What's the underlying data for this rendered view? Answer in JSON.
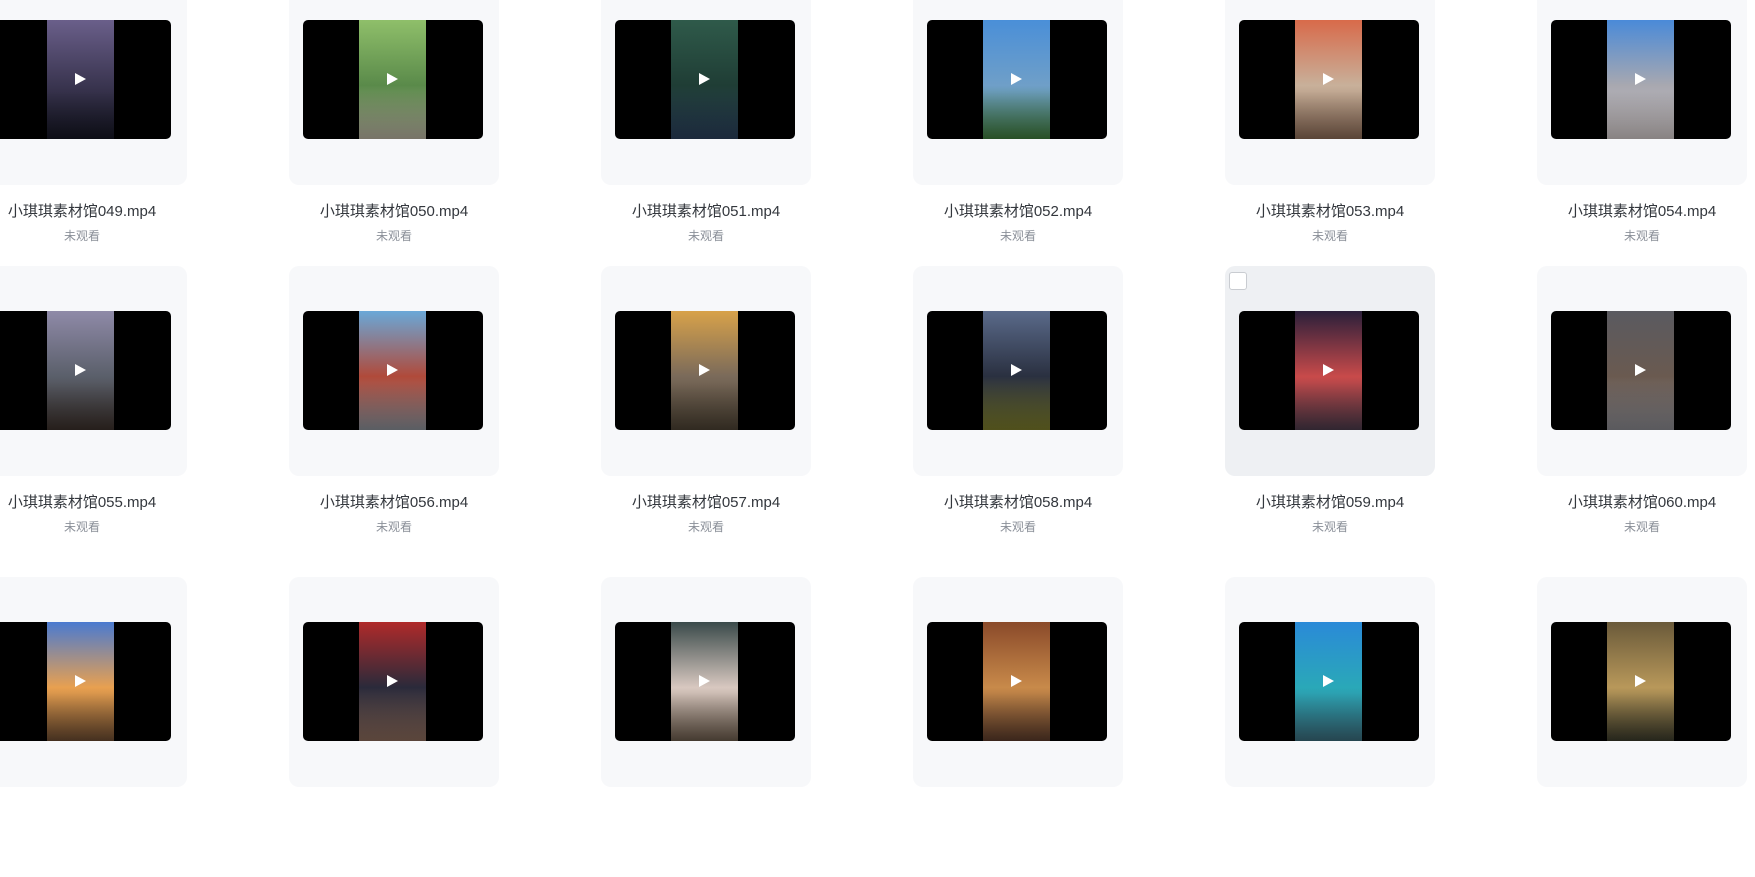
{
  "files": [
    {
      "name": "小琪琪素材馆049.mp4",
      "status": "未观看",
      "colors": [
        "#6a5f8a",
        "#3a3550",
        "#141522"
      ]
    },
    {
      "name": "小琪琪素材馆050.mp4",
      "status": "未观看",
      "colors": [
        "#8fbf6a",
        "#5a8a4a",
        "#b8b2a0"
      ]
    },
    {
      "name": "小琪琪素材馆051.mp4",
      "status": "未观看",
      "colors": [
        "#2f5a4a",
        "#1f3d35",
        "#2a3f5a"
      ]
    },
    {
      "name": "小琪琪素材馆052.mp4",
      "status": "未观看",
      "colors": [
        "#4a8fd8",
        "#6f9fc8",
        "#3f7a3a"
      ]
    },
    {
      "name": "小琪琪素材馆053.mp4",
      "status": "未观看",
      "colors": [
        "#d86a4a",
        "#c8b09a",
        "#8a6a55"
      ]
    },
    {
      "name": "小琪琪素材馆054.mp4",
      "status": "未观看",
      "colors": [
        "#4a8ad8",
        "#a8a8b0",
        "#d0c8c8"
      ]
    },
    {
      "name": "小琪琪素材馆055.mp4",
      "status": "未观看",
      "colors": [
        "#8f8aa8",
        "#5a5f6a",
        "#3a2f2a"
      ]
    },
    {
      "name": "小琪琪素材馆056.mp4",
      "status": "未观看",
      "colors": [
        "#6aa8d8",
        "#b04a3a",
        "#8a9098"
      ]
    },
    {
      "name": "小琪琪素材馆057.mp4",
      "status": "未观看",
      "colors": [
        "#d8a24a",
        "#7a6a5a",
        "#4a4032"
      ]
    },
    {
      "name": "小琪琪素材馆058.mp4",
      "status": "未观看",
      "colors": [
        "#5a6a8a",
        "#2a3040",
        "#7a7a2a"
      ]
    },
    {
      "name": "小琪琪素材馆059.mp4",
      "status": "未观看",
      "colors": [
        "#2a1f3a",
        "#c84a4a",
        "#4a3a4a"
      ],
      "hovered": true,
      "checkbox": true
    },
    {
      "name": "小琪琪素材馆060.mp4",
      "status": "未观看",
      "colors": [
        "#5a5a60",
        "#6a5a50",
        "#8a8a90"
      ]
    },
    {
      "name": "",
      "status": "",
      "colors": [
        "#4a7ad0",
        "#e8a050",
        "#6a4a30"
      ]
    },
    {
      "name": "",
      "status": "",
      "colors": [
        "#b02a2a",
        "#2a2a3a",
        "#8a6a5a"
      ]
    },
    {
      "name": "",
      "status": "",
      "colors": [
        "#3a4a4a",
        "#d8c8c0",
        "#6a5a4a"
      ]
    },
    {
      "name": "",
      "status": "",
      "colors": [
        "#8a4a2a",
        "#c88a4a",
        "#5a3a2a"
      ]
    },
    {
      "name": "",
      "status": "",
      "colors": [
        "#2a8ad8",
        "#2aa8b8",
        "#3a6a7a"
      ]
    },
    {
      "name": "",
      "status": "",
      "colors": [
        "#6a5a3a",
        "#b8985a",
        "#3a3a2a"
      ]
    }
  ]
}
